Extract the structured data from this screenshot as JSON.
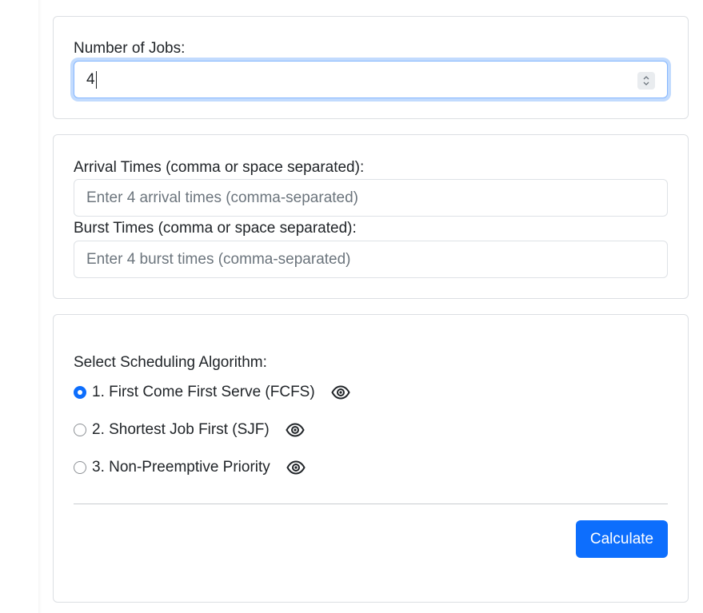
{
  "jobs_section": {
    "label": "Number of Jobs:",
    "value": "4"
  },
  "times_section": {
    "arrival_label": "Arrival Times (comma or space separated):",
    "arrival_placeholder": "Enter 4 arrival times (comma-separated)",
    "burst_label": "Burst Times (comma or space separated):",
    "burst_placeholder": "Enter 4 burst times (comma-separated)"
  },
  "algorithm_section": {
    "label": "Select Scheduling Algorithm:",
    "options": [
      {
        "label": "1. First Come First Serve (FCFS)",
        "selected": true,
        "icon": "eye-icon"
      },
      {
        "label": "2. Shortest Job First (SJF)",
        "selected": false,
        "icon": "eye-icon"
      },
      {
        "label": "3. Non-Preemptive Priority",
        "selected": false,
        "icon": "eye-icon"
      }
    ],
    "calculate_label": "Calculate"
  },
  "colors": {
    "accent": "#0d6efd",
    "border": "#dcdfe3",
    "focus_ring": "#86b7fe",
    "text": "#212529",
    "placeholder": "#6c757d"
  }
}
